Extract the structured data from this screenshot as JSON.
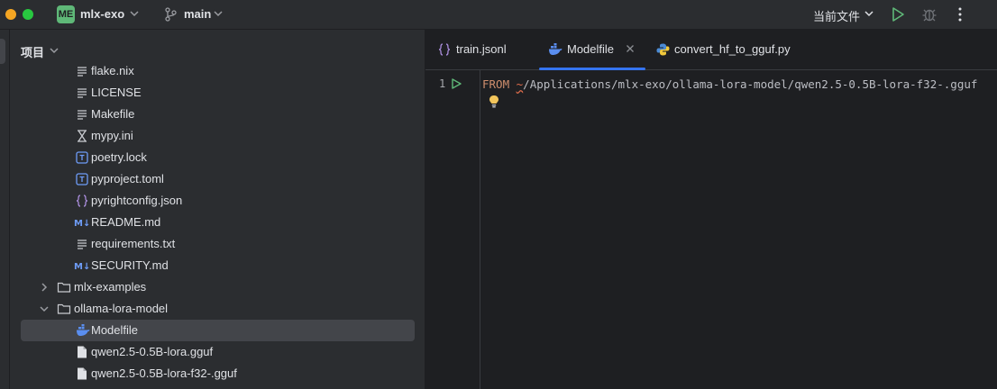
{
  "titlebar": {
    "project_badge": "ME",
    "project_name": "mlx-exo",
    "branch": "main",
    "run_config": "当前文件"
  },
  "project_panel": {
    "title": "项目",
    "items": [
      {
        "label": "flake.nix",
        "icon": "text-file-icon"
      },
      {
        "label": "LICENSE",
        "icon": "text-file-icon"
      },
      {
        "label": "Makefile",
        "icon": "text-file-icon"
      },
      {
        "label": "mypy.ini",
        "icon": "ini-file-icon"
      },
      {
        "label": "poetry.lock",
        "icon": "toml-file-icon"
      },
      {
        "label": "pyproject.toml",
        "icon": "toml-file-icon"
      },
      {
        "label": "pyrightconfig.json",
        "icon": "json-file-icon"
      },
      {
        "label": "README.md",
        "icon": "markdown-file-icon"
      },
      {
        "label": "requirements.txt",
        "icon": "text-file-icon"
      },
      {
        "label": "SECURITY.md",
        "icon": "markdown-file-icon"
      },
      {
        "label": "mlx-examples",
        "icon": "folder-icon",
        "expanded": false
      },
      {
        "label": "ollama-lora-model",
        "icon": "folder-icon",
        "expanded": true
      },
      {
        "label": "Modelfile",
        "icon": "docker-icon",
        "selected": true
      },
      {
        "label": "qwen2.5-0.5B-lora.gguf",
        "icon": "file-icon"
      },
      {
        "label": "qwen2.5-0.5B-lora-f32-.gguf",
        "icon": "file-icon"
      }
    ]
  },
  "editor": {
    "tabs": [
      {
        "label": "train.jsonl",
        "icon": "json-file-icon",
        "active": false
      },
      {
        "label": "Modelfile",
        "icon": "docker-icon",
        "active": true
      },
      {
        "label": "convert_hf_to_gguf.py",
        "icon": "python-icon",
        "active": false
      }
    ],
    "line_number": "1",
    "code": {
      "keyword": "FROM",
      "space": " ",
      "tilde": "~",
      "path": "/Applications/mlx-exo/ollama-lora-model/qwen2.5-0.5B-lora-f32-.gguf"
    }
  },
  "colors": {
    "accent": "#3574f0",
    "run_green": "#5fb878",
    "keyword": "#cf8e6d",
    "error_tilde": "#e06c4b"
  }
}
